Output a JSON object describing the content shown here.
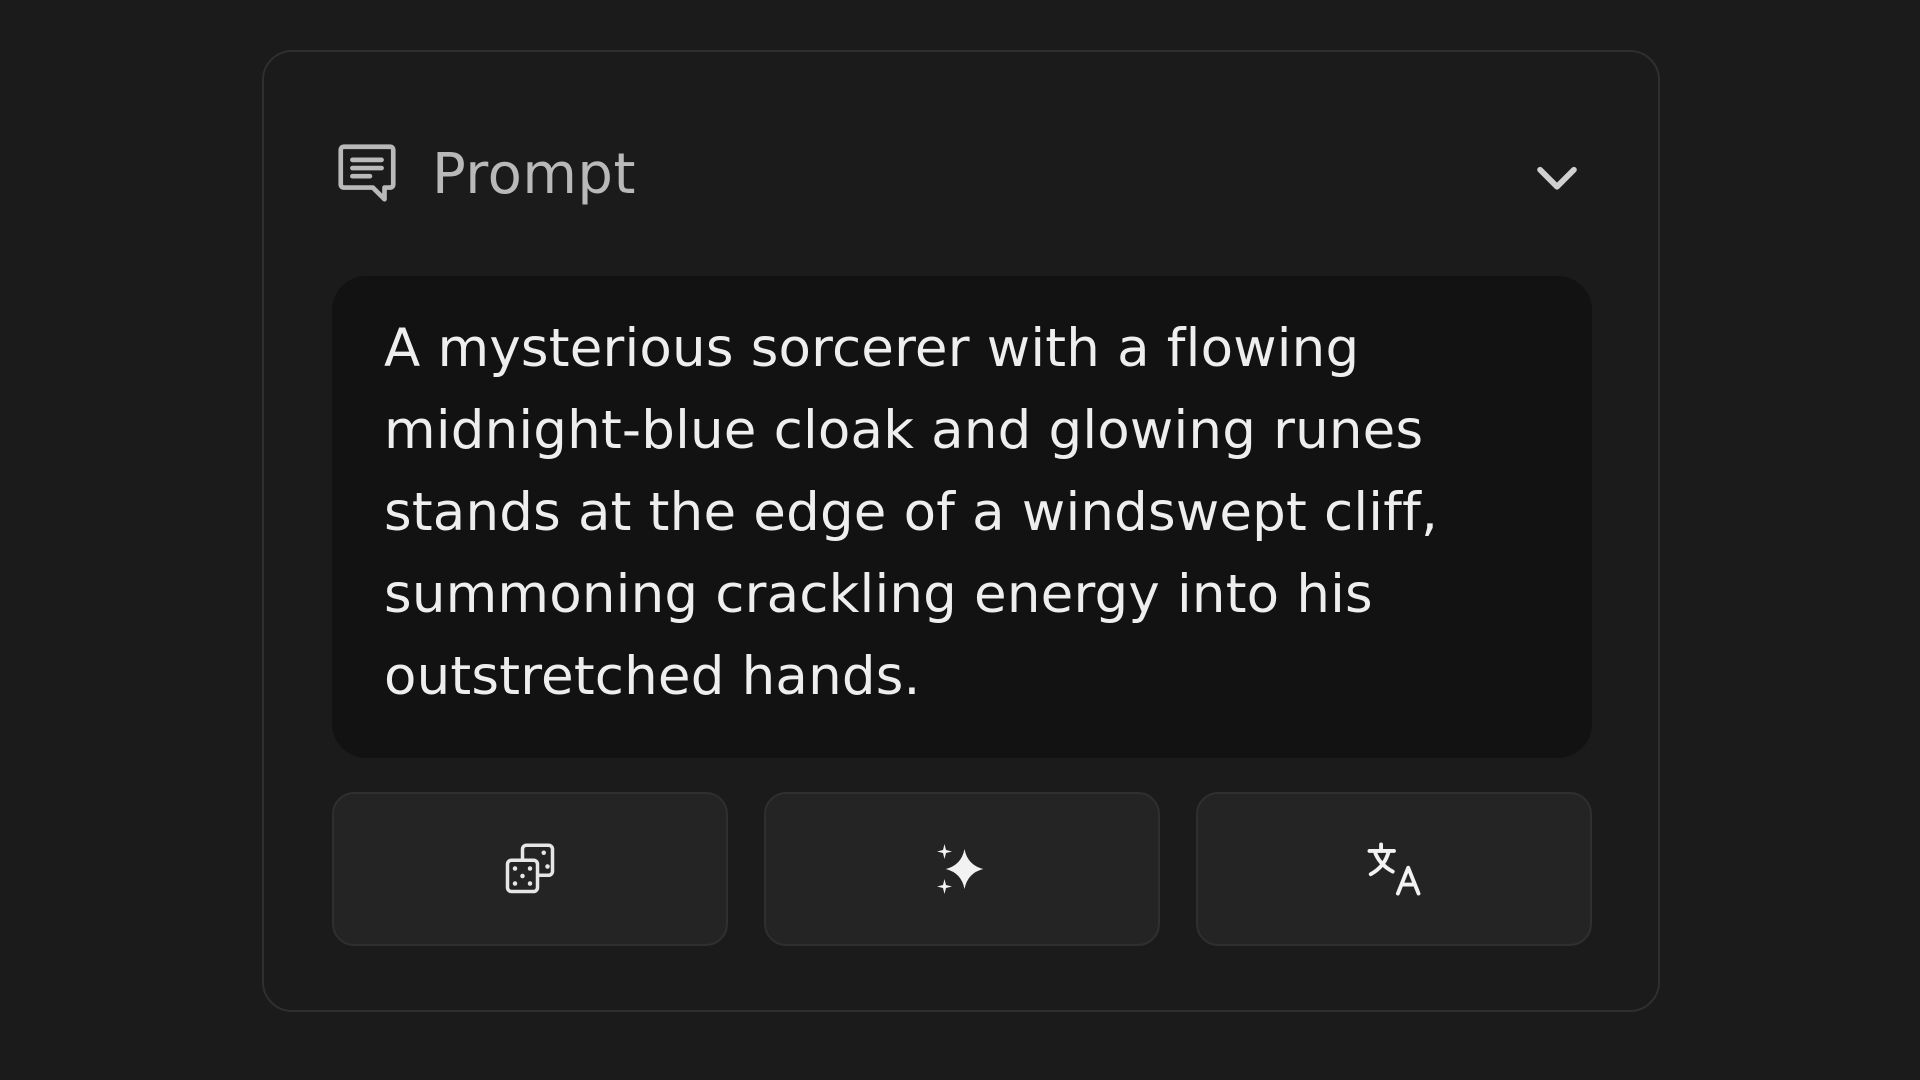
{
  "panel": {
    "header": {
      "icon": "message-square-text-icon",
      "title": "Prompt",
      "collapse_icon": "chevron-down-icon"
    },
    "prompt": {
      "text": "A mysterious sorcerer with a flowing midnight-blue cloak and glowing runes stands at the edge of a windswept cliff, summoning crackling energy into his outstretched hands."
    },
    "actions": [
      {
        "icon": "dice-icon",
        "purpose": "randomize"
      },
      {
        "icon": "sparkles-icon",
        "purpose": "enhance"
      },
      {
        "icon": "translate-icon",
        "purpose": "translate"
      }
    ]
  },
  "colors": {
    "background": "#1b1b1b",
    "panel_border": "#2f2f2f",
    "prompt_background": "#121212",
    "button_background": "#242424",
    "title_text": "#b9b9b9",
    "prompt_text": "#eeeeee"
  }
}
